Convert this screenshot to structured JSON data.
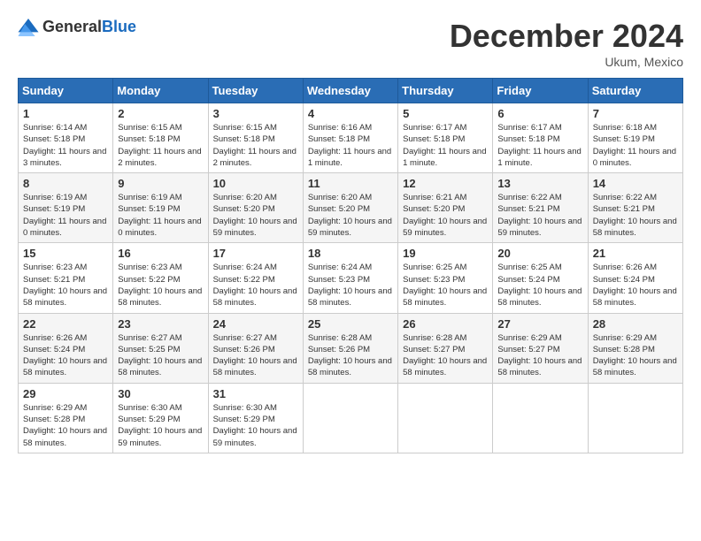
{
  "header": {
    "logo_general": "General",
    "logo_blue": "Blue",
    "title": "December 2024",
    "location": "Ukum, Mexico"
  },
  "weekdays": [
    "Sunday",
    "Monday",
    "Tuesday",
    "Wednesday",
    "Thursday",
    "Friday",
    "Saturday"
  ],
  "weeks": [
    [
      {
        "day": "1",
        "sunrise": "6:14 AM",
        "sunset": "5:18 PM",
        "daylight": "11 hours and 3 minutes."
      },
      {
        "day": "2",
        "sunrise": "6:15 AM",
        "sunset": "5:18 PM",
        "daylight": "11 hours and 2 minutes."
      },
      {
        "day": "3",
        "sunrise": "6:15 AM",
        "sunset": "5:18 PM",
        "daylight": "11 hours and 2 minutes."
      },
      {
        "day": "4",
        "sunrise": "6:16 AM",
        "sunset": "5:18 PM",
        "daylight": "11 hours and 1 minute."
      },
      {
        "day": "5",
        "sunrise": "6:17 AM",
        "sunset": "5:18 PM",
        "daylight": "11 hours and 1 minute."
      },
      {
        "day": "6",
        "sunrise": "6:17 AM",
        "sunset": "5:18 PM",
        "daylight": "11 hours and 1 minute."
      },
      {
        "day": "7",
        "sunrise": "6:18 AM",
        "sunset": "5:19 PM",
        "daylight": "11 hours and 0 minutes."
      }
    ],
    [
      {
        "day": "8",
        "sunrise": "6:19 AM",
        "sunset": "5:19 PM",
        "daylight": "11 hours and 0 minutes."
      },
      {
        "day": "9",
        "sunrise": "6:19 AM",
        "sunset": "5:19 PM",
        "daylight": "11 hours and 0 minutes."
      },
      {
        "day": "10",
        "sunrise": "6:20 AM",
        "sunset": "5:20 PM",
        "daylight": "10 hours and 59 minutes."
      },
      {
        "day": "11",
        "sunrise": "6:20 AM",
        "sunset": "5:20 PM",
        "daylight": "10 hours and 59 minutes."
      },
      {
        "day": "12",
        "sunrise": "6:21 AM",
        "sunset": "5:20 PM",
        "daylight": "10 hours and 59 minutes."
      },
      {
        "day": "13",
        "sunrise": "6:22 AM",
        "sunset": "5:21 PM",
        "daylight": "10 hours and 59 minutes."
      },
      {
        "day": "14",
        "sunrise": "6:22 AM",
        "sunset": "5:21 PM",
        "daylight": "10 hours and 58 minutes."
      }
    ],
    [
      {
        "day": "15",
        "sunrise": "6:23 AM",
        "sunset": "5:21 PM",
        "daylight": "10 hours and 58 minutes."
      },
      {
        "day": "16",
        "sunrise": "6:23 AM",
        "sunset": "5:22 PM",
        "daylight": "10 hours and 58 minutes."
      },
      {
        "day": "17",
        "sunrise": "6:24 AM",
        "sunset": "5:22 PM",
        "daylight": "10 hours and 58 minutes."
      },
      {
        "day": "18",
        "sunrise": "6:24 AM",
        "sunset": "5:23 PM",
        "daylight": "10 hours and 58 minutes."
      },
      {
        "day": "19",
        "sunrise": "6:25 AM",
        "sunset": "5:23 PM",
        "daylight": "10 hours and 58 minutes."
      },
      {
        "day": "20",
        "sunrise": "6:25 AM",
        "sunset": "5:24 PM",
        "daylight": "10 hours and 58 minutes."
      },
      {
        "day": "21",
        "sunrise": "6:26 AM",
        "sunset": "5:24 PM",
        "daylight": "10 hours and 58 minutes."
      }
    ],
    [
      {
        "day": "22",
        "sunrise": "6:26 AM",
        "sunset": "5:24 PM",
        "daylight": "10 hours and 58 minutes."
      },
      {
        "day": "23",
        "sunrise": "6:27 AM",
        "sunset": "5:25 PM",
        "daylight": "10 hours and 58 minutes."
      },
      {
        "day": "24",
        "sunrise": "6:27 AM",
        "sunset": "5:26 PM",
        "daylight": "10 hours and 58 minutes."
      },
      {
        "day": "25",
        "sunrise": "6:28 AM",
        "sunset": "5:26 PM",
        "daylight": "10 hours and 58 minutes."
      },
      {
        "day": "26",
        "sunrise": "6:28 AM",
        "sunset": "5:27 PM",
        "daylight": "10 hours and 58 minutes."
      },
      {
        "day": "27",
        "sunrise": "6:29 AM",
        "sunset": "5:27 PM",
        "daylight": "10 hours and 58 minutes."
      },
      {
        "day": "28",
        "sunrise": "6:29 AM",
        "sunset": "5:28 PM",
        "daylight": "10 hours and 58 minutes."
      }
    ],
    [
      {
        "day": "29",
        "sunrise": "6:29 AM",
        "sunset": "5:28 PM",
        "daylight": "10 hours and 58 minutes."
      },
      {
        "day": "30",
        "sunrise": "6:30 AM",
        "sunset": "5:29 PM",
        "daylight": "10 hours and 59 minutes."
      },
      {
        "day": "31",
        "sunrise": "6:30 AM",
        "sunset": "5:29 PM",
        "daylight": "10 hours and 59 minutes."
      },
      null,
      null,
      null,
      null
    ]
  ]
}
